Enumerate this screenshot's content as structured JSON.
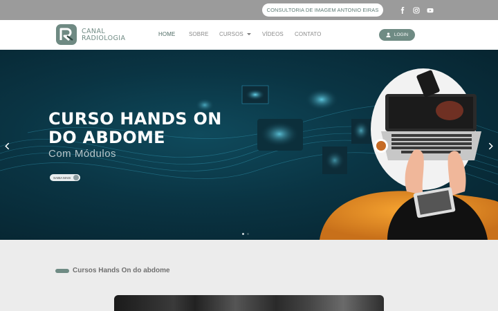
{
  "topbar": {
    "consult_label": "CONSULTORIA DE IMAGEM ANTONIO EIRAS",
    "social": [
      "facebook-icon",
      "instagram-icon",
      "youtube-icon"
    ]
  },
  "brand": {
    "line1": "CANAL",
    "line2": "RADIOLOGIA",
    "color": "#6f8a83"
  },
  "nav": {
    "items": [
      {
        "label": "HOME",
        "active": true
      },
      {
        "label": "SOBRE",
        "active": false
      },
      {
        "label": "CURSOS",
        "active": false
      },
      {
        "label": "VÍDEOS",
        "active": false
      },
      {
        "label": "CONTATO",
        "active": false
      }
    ],
    "login_label": "LOGIN"
  },
  "hero": {
    "title_line1": "CURSO HANDS ON",
    "title_line2": "DO ABDOME",
    "subtitle": "Com Módulos",
    "cta_label": "SAIBA MAIS",
    "slides_total": 2,
    "slide_active": 1
  },
  "section": {
    "title": "Cursos Hands On do abdome"
  },
  "colors": {
    "accent": "#6f8b84",
    "topbar": "#9b9b9b",
    "hero_bg": "#0a3443"
  }
}
